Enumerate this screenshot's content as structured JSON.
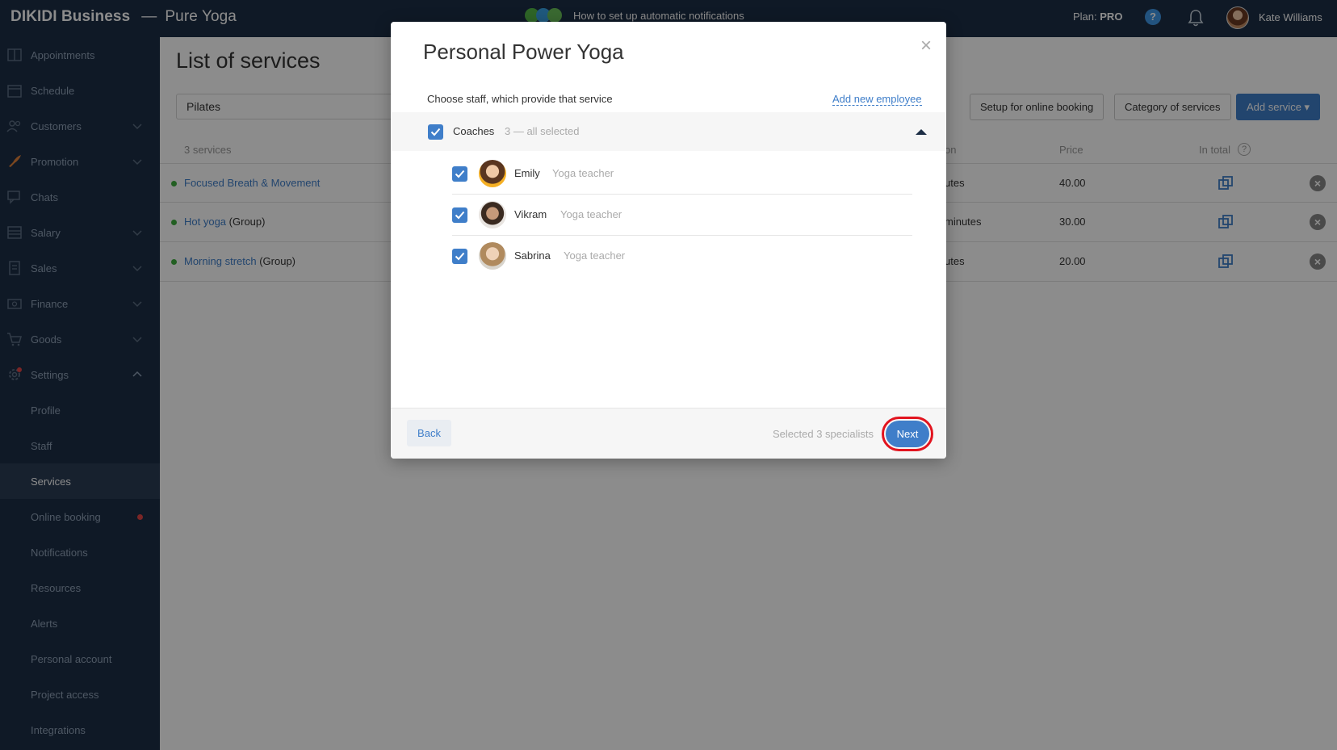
{
  "topbar": {
    "brand": "DIKIDI Business",
    "separator": "—",
    "project": "Pure Yoga",
    "promo_text": "How to set up automatic notifications",
    "plan_label": "Plan:",
    "plan_value": "PRO",
    "help_symbol": "?",
    "user_name": "Kate Williams"
  },
  "sidebar": {
    "items": [
      {
        "label": "Appointments",
        "icon": "book-icon"
      },
      {
        "label": "Schedule",
        "icon": "calendar-icon"
      },
      {
        "label": "Customers",
        "icon": "users-icon",
        "expandable": true
      },
      {
        "label": "Promotion",
        "icon": "rocket-icon",
        "expandable": true
      },
      {
        "label": "Chats",
        "icon": "chat-icon"
      },
      {
        "label": "Salary",
        "icon": "salary-icon",
        "expandable": true
      },
      {
        "label": "Sales",
        "icon": "receipt-icon",
        "expandable": true
      },
      {
        "label": "Finance",
        "icon": "money-icon",
        "expandable": true
      },
      {
        "label": "Goods",
        "icon": "cart-icon",
        "expandable": true
      },
      {
        "label": "Settings",
        "icon": "gear-icon",
        "expanded": true
      }
    ],
    "settings_sub": [
      {
        "label": "Profile"
      },
      {
        "label": "Staff"
      },
      {
        "label": "Services",
        "active": true
      },
      {
        "label": "Online booking",
        "dot": true
      },
      {
        "label": "Notifications"
      },
      {
        "label": "Resources"
      },
      {
        "label": "Alerts"
      },
      {
        "label": "Personal account"
      },
      {
        "label": "Project access"
      },
      {
        "label": "Integrations"
      }
    ]
  },
  "main": {
    "title": "List of services",
    "search_value": "Pilates",
    "buttons": {
      "setup_online": "Setup for online booking",
      "category": "Category of services",
      "add_service": "Add service ▾"
    },
    "list_header": {
      "count": "3 services",
      "duration_partial": "on",
      "price": "Price",
      "in_total": "In total"
    },
    "rows": [
      {
        "name": "Focused Breath & Movement",
        "group": "",
        "duration_partial": "utes",
        "price": "40.00"
      },
      {
        "name": "Hot yoga",
        "group": "(Group)",
        "duration_partial": "minutes",
        "price": "30.00"
      },
      {
        "name": "Morning stretch",
        "group": "(Group)",
        "duration_partial": "utes",
        "price": "20.00"
      }
    ]
  },
  "modal": {
    "title": "Personal Power Yoga",
    "close_symbol": "×",
    "subtitle": "Choose staff, which provide that service",
    "add_employee": "Add new employee",
    "group": {
      "name": "Coaches",
      "count": "3 — all selected",
      "checked": true
    },
    "employees": [
      {
        "name": "Emily",
        "role": "Yoga teacher",
        "checked": true
      },
      {
        "name": "Vikram",
        "role": "Yoga teacher",
        "checked": true
      },
      {
        "name": "Sabrina",
        "role": "Yoga teacher",
        "checked": true
      }
    ],
    "back_label": "Back",
    "selected_text": "Selected 3 specialists",
    "next_label": "Next"
  },
  "colors": {
    "nav_bg": "#1d2e45",
    "accent": "#3f7ec9",
    "highlight_ring": "#e2141f"
  }
}
